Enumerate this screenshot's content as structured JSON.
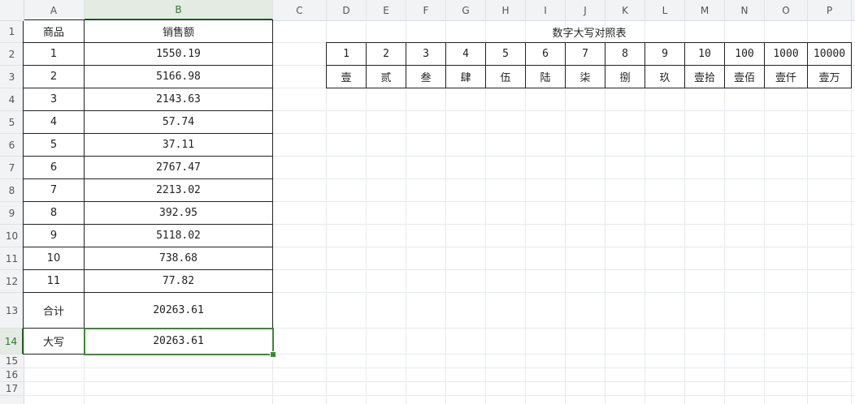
{
  "columns": [
    "A",
    "B",
    "C",
    "D",
    "E",
    "F",
    "G",
    "H",
    "I",
    "J",
    "K",
    "L",
    "M",
    "N",
    "O",
    "P"
  ],
  "rows": [
    "1",
    "2",
    "3",
    "4",
    "5",
    "6",
    "7",
    "8",
    "9",
    "10",
    "11",
    "12",
    "13",
    "14",
    "15",
    "16",
    "17"
  ],
  "active_column": "B",
  "active_row": "14",
  "sales_table": {
    "header": {
      "item": "商品",
      "amount": "销售额"
    },
    "items": [
      {
        "item": "1",
        "amount": "1550.19"
      },
      {
        "item": "2",
        "amount": "5166.98"
      },
      {
        "item": "3",
        "amount": "2143.63"
      },
      {
        "item": "4",
        "amount": "57.74"
      },
      {
        "item": "5",
        "amount": "37.11"
      },
      {
        "item": "6",
        "amount": "2767.47"
      },
      {
        "item": "7",
        "amount": "2213.02"
      },
      {
        "item": "8",
        "amount": "392.95"
      },
      {
        "item": "9",
        "amount": "5118.02"
      },
      {
        "item": "10",
        "amount": "738.68"
      },
      {
        "item": "11",
        "amount": "77.82"
      }
    ],
    "total": {
      "label": "合计",
      "value": "20263.61"
    },
    "uppercase": {
      "label": "大写",
      "value": "20263.61"
    }
  },
  "lookup_table": {
    "title": "数字大写对照表",
    "numbers": [
      "1",
      "2",
      "3",
      "4",
      "5",
      "6",
      "7",
      "8",
      "9",
      "10",
      "100",
      "1000",
      "10000"
    ],
    "chars": [
      "壹",
      "贰",
      "叁",
      "肆",
      "伍",
      "陆",
      "柒",
      "捌",
      "玖",
      "壹拾",
      "壹佰",
      "壹仟",
      "壹万"
    ]
  }
}
